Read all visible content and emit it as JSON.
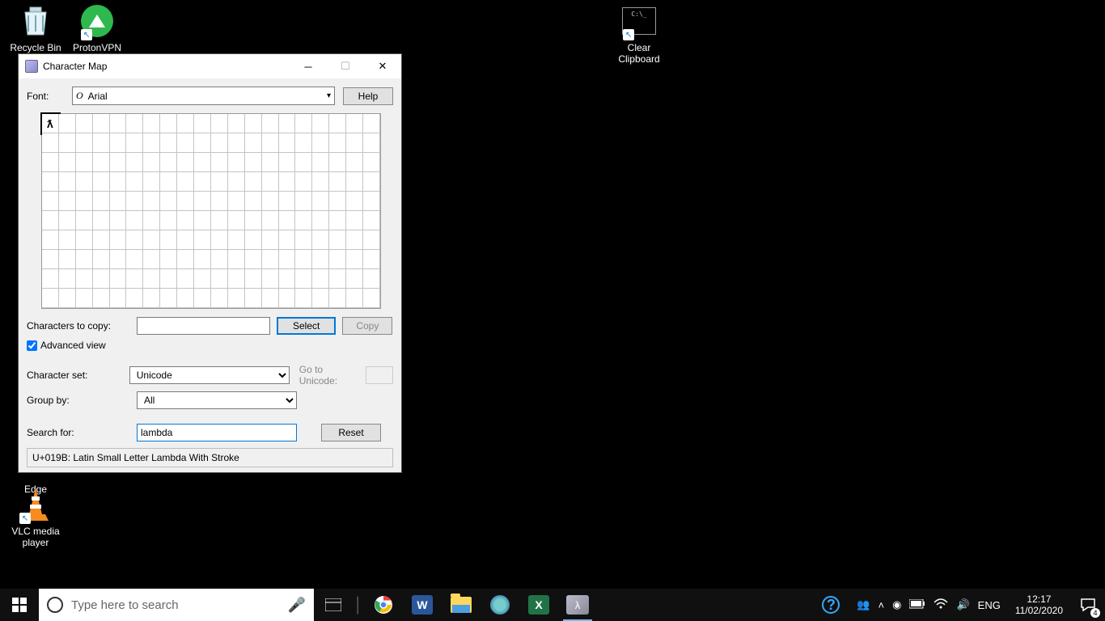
{
  "desktop": {
    "recycle": "Recycle Bin",
    "proton": "ProtonVPN",
    "clear": "Clear Clipboard",
    "edge": "Edge",
    "vlc": "VLC media player"
  },
  "window": {
    "title": "Character Map",
    "font_label": "Font:",
    "font_value": "Arial",
    "help_btn": "Help",
    "selected_char": "ƛ",
    "chars_to_copy_label": "Characters to copy:",
    "chars_to_copy_value": "",
    "select_btn": "Select",
    "copy_btn": "Copy",
    "advanced_label": "Advanced view",
    "advanced_checked": true,
    "charset_label": "Character set:",
    "charset_value": "Unicode",
    "goto_label": "Go to Unicode:",
    "goto_value": "",
    "groupby_label": "Group by:",
    "groupby_value": "All",
    "searchfor_label": "Search for:",
    "searchfor_value": "lambda",
    "reset_btn": "Reset",
    "status": "U+019B: Latin Small Letter Lambda With Stroke"
  },
  "taskbar": {
    "search_placeholder": "Type here to search",
    "lang": "ENG",
    "time": "12:17",
    "date": "11/02/2020",
    "notif_count": "4"
  }
}
